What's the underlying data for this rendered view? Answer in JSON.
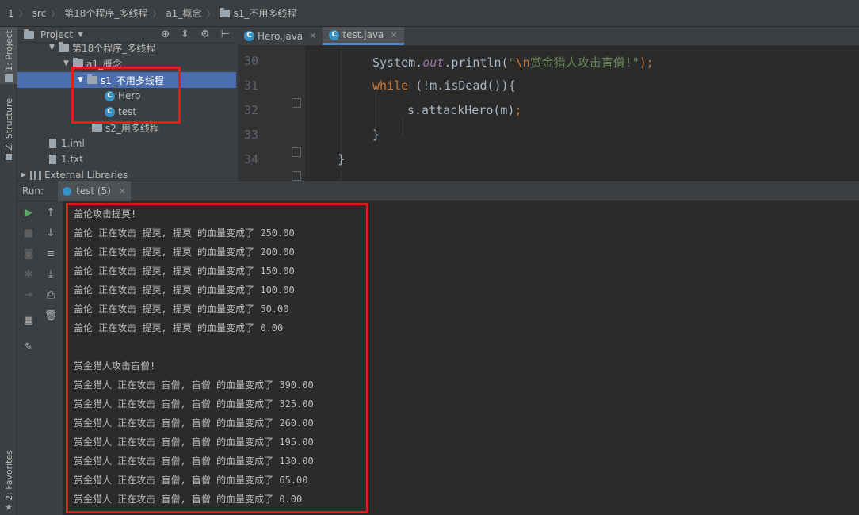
{
  "breadcrumb": {
    "items": [
      "1",
      "src",
      "第18个程序_多线程",
      "a1_概念",
      "s1_不用多线程"
    ]
  },
  "left_strip": {
    "project_tab": "1: Project",
    "structure_tab": "Z: Structure",
    "favorites_tab": "2: Favorites"
  },
  "project_panel": {
    "title": "Project",
    "tree": [
      {
        "label": "第18个程序_多线程",
        "icon": "folder-icon",
        "expanded": true
      },
      {
        "label": "a1_概念",
        "icon": "folder-icon",
        "expanded": true
      },
      {
        "label": "s1_不用多线程",
        "icon": "folder-icon",
        "expanded": true,
        "selected": true
      },
      {
        "label": "Hero",
        "icon": "class-icon"
      },
      {
        "label": "test",
        "icon": "class-icon"
      },
      {
        "label": "s2_用多线程",
        "icon": "folder-icon"
      },
      {
        "label": "1.iml",
        "icon": "file-icon"
      },
      {
        "label": "1.txt",
        "icon": "file-icon"
      },
      {
        "label": "External Libraries",
        "icon": "library-icon"
      }
    ]
  },
  "editor": {
    "tabs": [
      {
        "label": "Hero.java",
        "active": false
      },
      {
        "label": "test.java",
        "active": true
      }
    ],
    "line_numbers": [
      "30",
      "31",
      "32",
      "33",
      "34"
    ],
    "code": {
      "l30_obj": "System.",
      "l30_field": "out",
      "l30_call": ".println(",
      "l30_quote": "\"",
      "l30_escape": "\\n",
      "l30_str": "赏金猎人攻击盲僧!\"",
      "l30_end": ");",
      "l31_kw": "while",
      "l31_rest": " (!m.isDead()){",
      "l32_call": "s.attackHero(m)",
      "l32_end": ";",
      "l33": "}",
      "l34": "}"
    }
  },
  "run": {
    "label": "Run:",
    "tab": "test (5)"
  },
  "console": {
    "lines": [
      "盖伦攻击提莫!",
      "盖伦 正在攻击 提莫, 提莫 的血量变成了 250.00",
      "盖伦 正在攻击 提莫, 提莫 的血量变成了 200.00",
      "盖伦 正在攻击 提莫, 提莫 的血量变成了 150.00",
      "盖伦 正在攻击 提莫, 提莫 的血量变成了 100.00",
      "盖伦 正在攻击 提莫, 提莫 的血量变成了 50.00",
      "盖伦 正在攻击 提莫, 提莫 的血量变成了 0.00",
      "",
      "赏金猎人攻击盲僧!",
      "赏金猎人 正在攻击 盲僧, 盲僧 的血量变成了 390.00",
      "赏金猎人 正在攻击 盲僧, 盲僧 的血量变成了 325.00",
      "赏金猎人 正在攻击 盲僧, 盲僧 的血量变成了 260.00",
      "赏金猎人 正在攻击 盲僧, 盲僧 的血量变成了 195.00",
      "赏金猎人 正在攻击 盲僧, 盲僧 的血量变成了 130.00",
      "赏金猎人 正在攻击 盲僧, 盲僧 的血量变成了 65.00",
      "赏金猎人 正在攻击 盲僧, 盲僧 的血量变成了 0.00"
    ]
  },
  "colors": {
    "annotation": "#e31b1b",
    "selection": "#4b6eaf",
    "class_icon": "#3592c4",
    "run_green": "#59a869"
  }
}
